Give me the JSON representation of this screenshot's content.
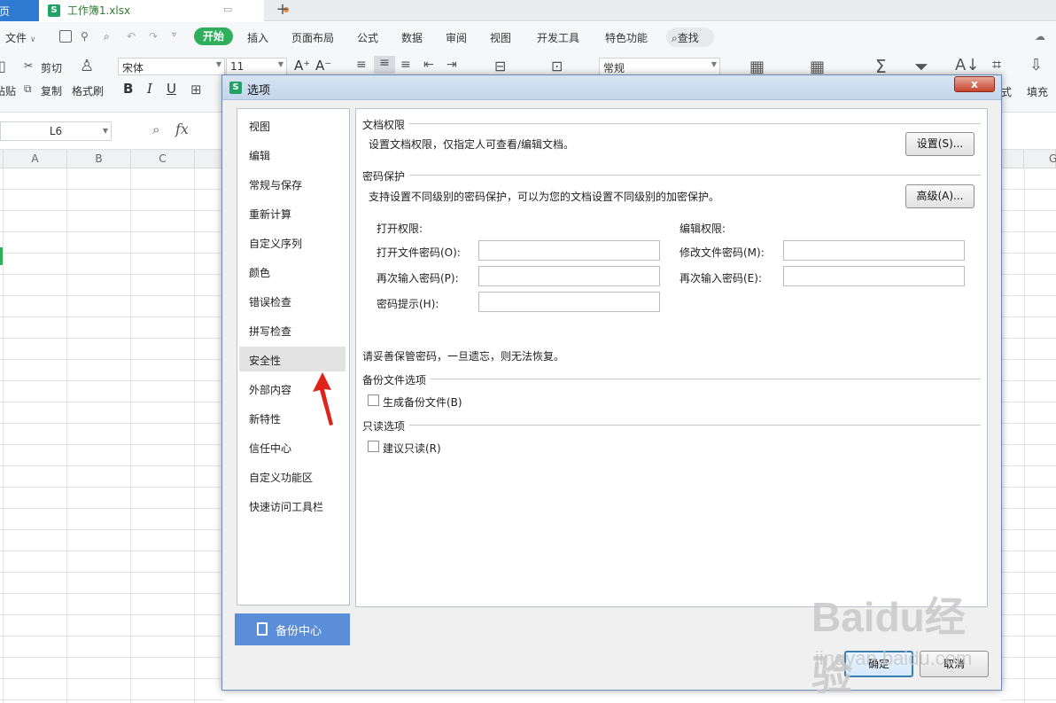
{
  "tabs": {
    "home_label": "首页",
    "file_name": "工作簿1.xlsx",
    "file_icon": "S",
    "add_label": "+"
  },
  "menu": {
    "file_label": "文件",
    "items": [
      "开始",
      "插入",
      "页面布局",
      "公式",
      "数据",
      "审阅",
      "视图",
      "开发工具",
      "特色功能"
    ],
    "search_label": "查找"
  },
  "ribbon": {
    "cut_label": "剪切",
    "copy_label": "复制",
    "paste_label": "粘贴",
    "format_painter_label": "格式刷",
    "font_name": "宋体",
    "font_size": "11",
    "bold": "B",
    "italic": "I",
    "underline": "U",
    "number_format": "常规",
    "fill_label": "填充",
    "style_label": "式"
  },
  "formula_bar": {
    "name_box": "L6",
    "fx": "fx"
  },
  "sheet": {
    "columns": [
      "A",
      "B",
      "C"
    ],
    "right_column": "G"
  },
  "dialog": {
    "title": "选项",
    "title_icon": "S",
    "close_label": "x",
    "nav_items": [
      "视图",
      "编辑",
      "常规与保存",
      "重新计算",
      "自定义序列",
      "颜色",
      "错误检查",
      "拼写检查",
      "安全性",
      "外部内容",
      "新特性",
      "信任中心",
      "自定义功能区",
      "快速访问工具栏"
    ],
    "selected_nav": "安全性",
    "backup_center_label": "备份中心",
    "doc_permission": {
      "heading": "文档权限",
      "description": "设置文档权限，仅指定人可查看/编辑文档。",
      "button": "设置(S)..."
    },
    "password_protection": {
      "heading": "密码保护",
      "description": "支持设置不同级别的密码保护，可以为您的文档设置不同级别的加密保护。",
      "button": "高级(A)...",
      "open_heading": "打开权限:",
      "open_password_label": "打开文件密码(O):",
      "open_reenter_label": "再次输入密码(P):",
      "hint_label": "密码提示(H):",
      "edit_heading": "编辑权限:",
      "edit_password_label": "修改文件密码(M):",
      "edit_reenter_label": "再次输入密码(E):",
      "warning": "请妥善保管密码，一旦遗忘，则无法恢复。"
    },
    "backup_options": {
      "heading": "备份文件选项",
      "generate_backup_label": "生成备份文件(B)",
      "generate_backup_checked": false
    },
    "readonly_options": {
      "heading": "只读选项",
      "suggest_readonly_label": "建议只读(R)",
      "suggest_readonly_checked": false
    },
    "ok_label": "确定",
    "cancel_label": "取消"
  },
  "watermark": {
    "line1": "Baidu经验",
    "line2": "jingyan.baidu.com"
  },
  "colors": {
    "accent_green": "#2fae5b",
    "backup_button": "#5b8ed9",
    "arrow": "#e0241b"
  }
}
